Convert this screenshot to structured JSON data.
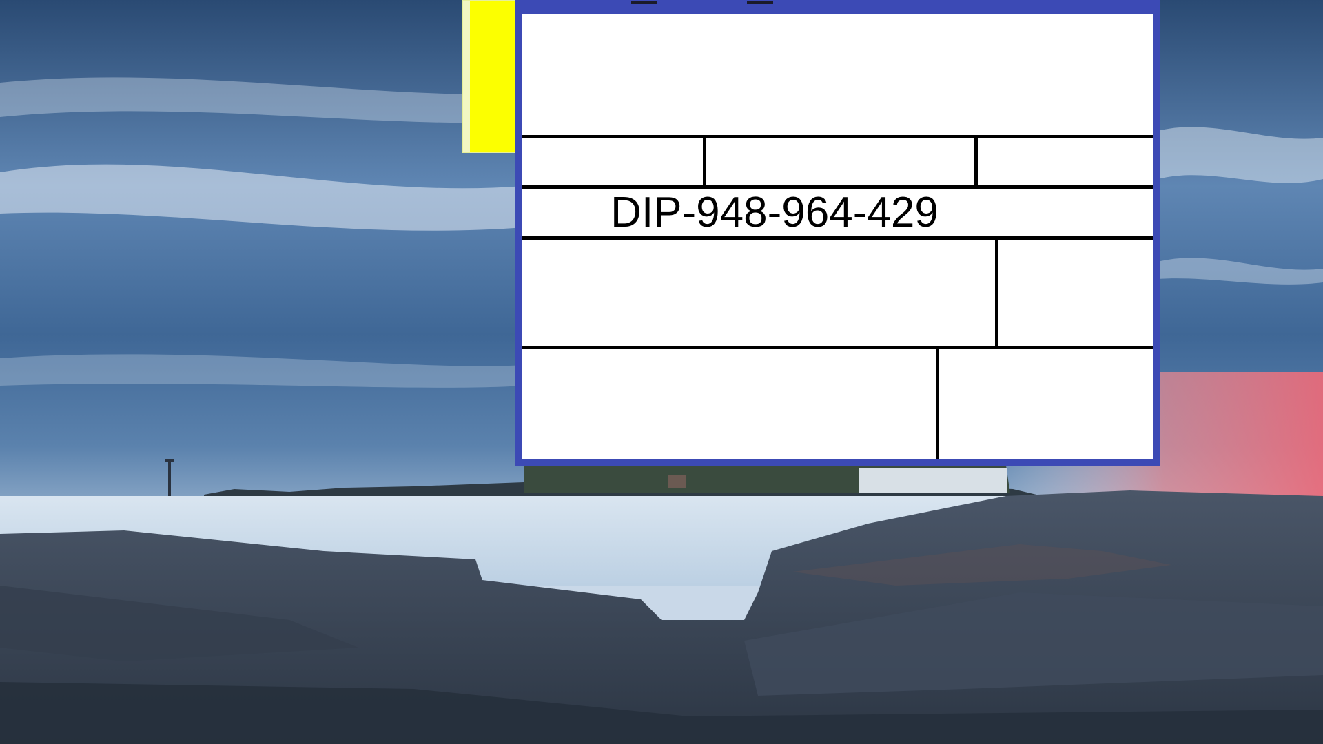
{
  "desktop": {
    "wallpaper": "coastal-rocks-lighthouse-dusk",
    "colors": {
      "sky_dark": "#2d4f78",
      "sky_light": "#c8dcef",
      "sunset": "#f07a80",
      "water": "#d5e3ef",
      "rock": "#3c4858"
    }
  },
  "background_window": {
    "color": "#fcff00"
  },
  "label_window": {
    "frame_color": "#3c4ab5",
    "tracking_number": "DIP-948-964-429"
  }
}
